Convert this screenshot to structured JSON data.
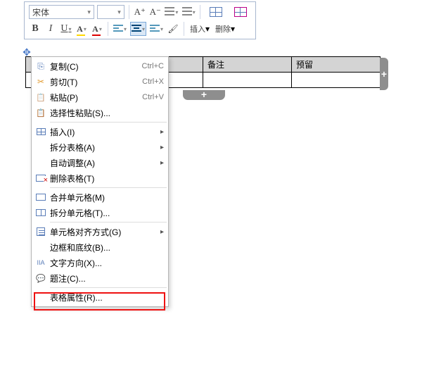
{
  "toolbar": {
    "font_name": "宋体",
    "insert_label": "插入",
    "delete_label": "删除",
    "a_plus": "A⁺",
    "a_minus": "A⁻"
  },
  "table": {
    "headers": [
      "",
      "",
      "备注",
      "预留"
    ]
  },
  "ctx": {
    "copy": "复制(C)",
    "copy_sc": "Ctrl+C",
    "cut": "剪切(T)",
    "cut_sc": "Ctrl+X",
    "paste": "粘贴(P)",
    "paste_sc": "Ctrl+V",
    "paste_special": "选择性粘贴(S)...",
    "insert": "插入(I)",
    "split_table": "拆分表格(A)",
    "auto_fit": "自动调整(A)",
    "delete_table": "删除表格(T)",
    "merge_cells": "合并单元格(M)",
    "split_cells": "拆分单元格(T)...",
    "cell_align": "单元格对齐方式(G)",
    "borders": "边框和底纹(B)...",
    "text_direction": "文字方向(X)...",
    "caption": "题注(C)...",
    "table_props": "表格属性(R)..."
  }
}
